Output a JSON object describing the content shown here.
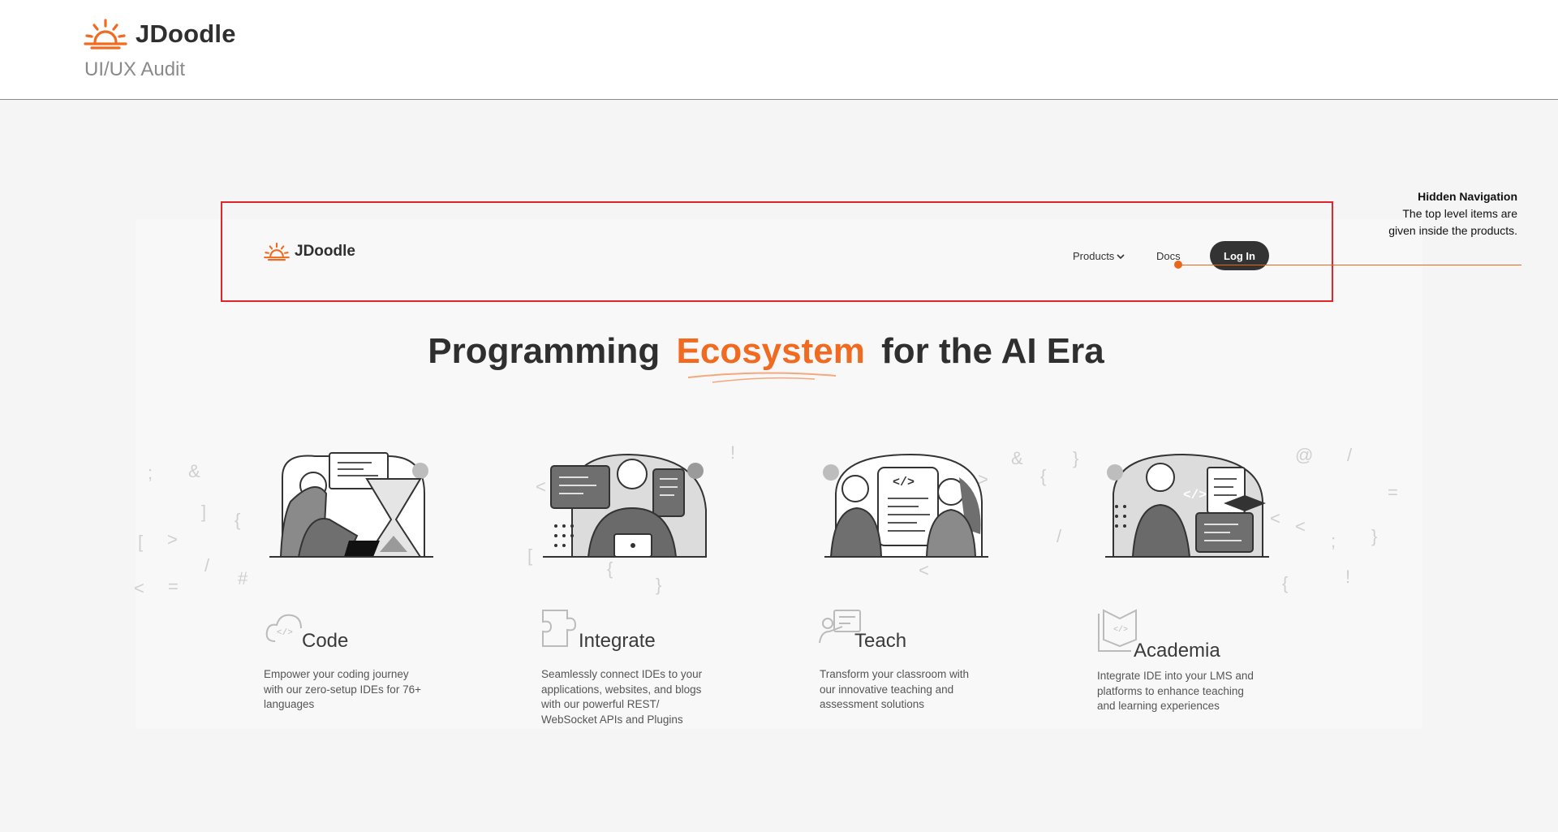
{
  "header": {
    "brand": "JDoodle",
    "subtitle": "UI/UX Audit"
  },
  "nav": {
    "brand": "JDoodle",
    "products": "Products",
    "docs": "Docs",
    "login": "Log In"
  },
  "annotation": {
    "title": "Hidden Navigation",
    "line1": "The top level items are",
    "line2": "given inside the products."
  },
  "hero": {
    "before": "Programming",
    "accent": "Ecosystem",
    "after": "for the AI Era"
  },
  "cards": [
    {
      "title": "Code",
      "l1": "Empower your coding journey",
      "l2": "with our zero-setup IDEs for 76+",
      "l3": "languages",
      "l4": ""
    },
    {
      "title": "Integrate",
      "l1": "Seamlessly connect IDEs to your",
      "l2": "applications, websites, and blogs",
      "l3": "with our powerful REST/",
      "l4": "WebSocket APIs and Plugins"
    },
    {
      "title": "Teach",
      "l1": "Transform your classroom with",
      "l2": "our innovative teaching and",
      "l3": "assessment solutions",
      "l4": ""
    },
    {
      "title": "Academia",
      "l1": "Integrate IDE into your LMS and",
      "l2": "platforms to enhance teaching",
      "l3": "and learning experiences",
      "l4": ""
    }
  ],
  "glyphs": [
    ";",
    "&",
    "]",
    "{",
    "[",
    ">",
    "/",
    "<",
    "=",
    "#",
    "!",
    "<",
    "[",
    "}",
    "&",
    "{",
    "}",
    ">",
    "/",
    "<",
    "@",
    "/",
    "=",
    "<",
    ";",
    "}",
    "{",
    "!",
    "<",
    "{",
    "}"
  ],
  "colors": {
    "accent": "#f06a20",
    "annotation_border": "#e0252d",
    "dark": "#333333"
  },
  "icons": {
    "logo": "sun-logo-icon",
    "products": "chevron-down-icon"
  }
}
